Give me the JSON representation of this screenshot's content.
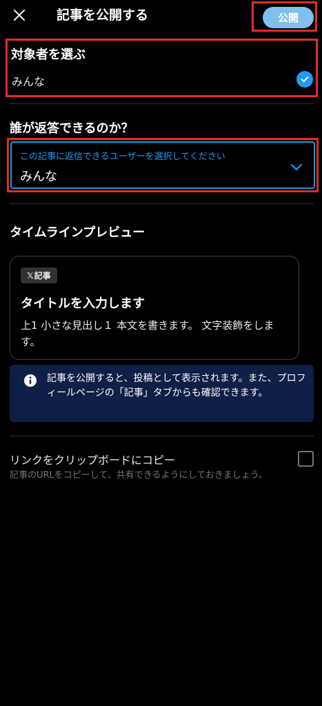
{
  "header": {
    "title": "記事を公開する",
    "publish_label": "公開",
    "close_icon": "close-icon"
  },
  "audience": {
    "title": "対象者を選ぶ",
    "value": "みんな",
    "selected": true,
    "check_icon": "check-circle-icon"
  },
  "reply": {
    "title": "誰が返答できるのか？",
    "select_label": "この記事に返信できるユーザーを選択してください",
    "select_value": "みんな",
    "chevron_icon": "chevron-down-icon"
  },
  "timeline_preview": {
    "title": "タイムラインプレビュー",
    "badge_logo": "𝕏",
    "badge_label": "記事",
    "card_title": "タイトルを入力します",
    "card_body": "上1 小さな見出し１ 本文を書きます。 文字装飾をします。"
  },
  "info": {
    "icon": "info-icon",
    "text": "記事を公開すると、投稿として表示されます。また、プロフィールページの「記事」タブからも確認できます。"
  },
  "copy_link": {
    "label": "リンクをクリップボードにコピー",
    "description": "記事のURLをコピーして、共有できるようにしておきましょう。",
    "checked": false
  },
  "colors": {
    "accent": "#1d9bf0",
    "publish_button": "#7fc1ee",
    "highlight_border": "#e0301e",
    "info_background": "#0f1f47",
    "background": "#000000"
  }
}
